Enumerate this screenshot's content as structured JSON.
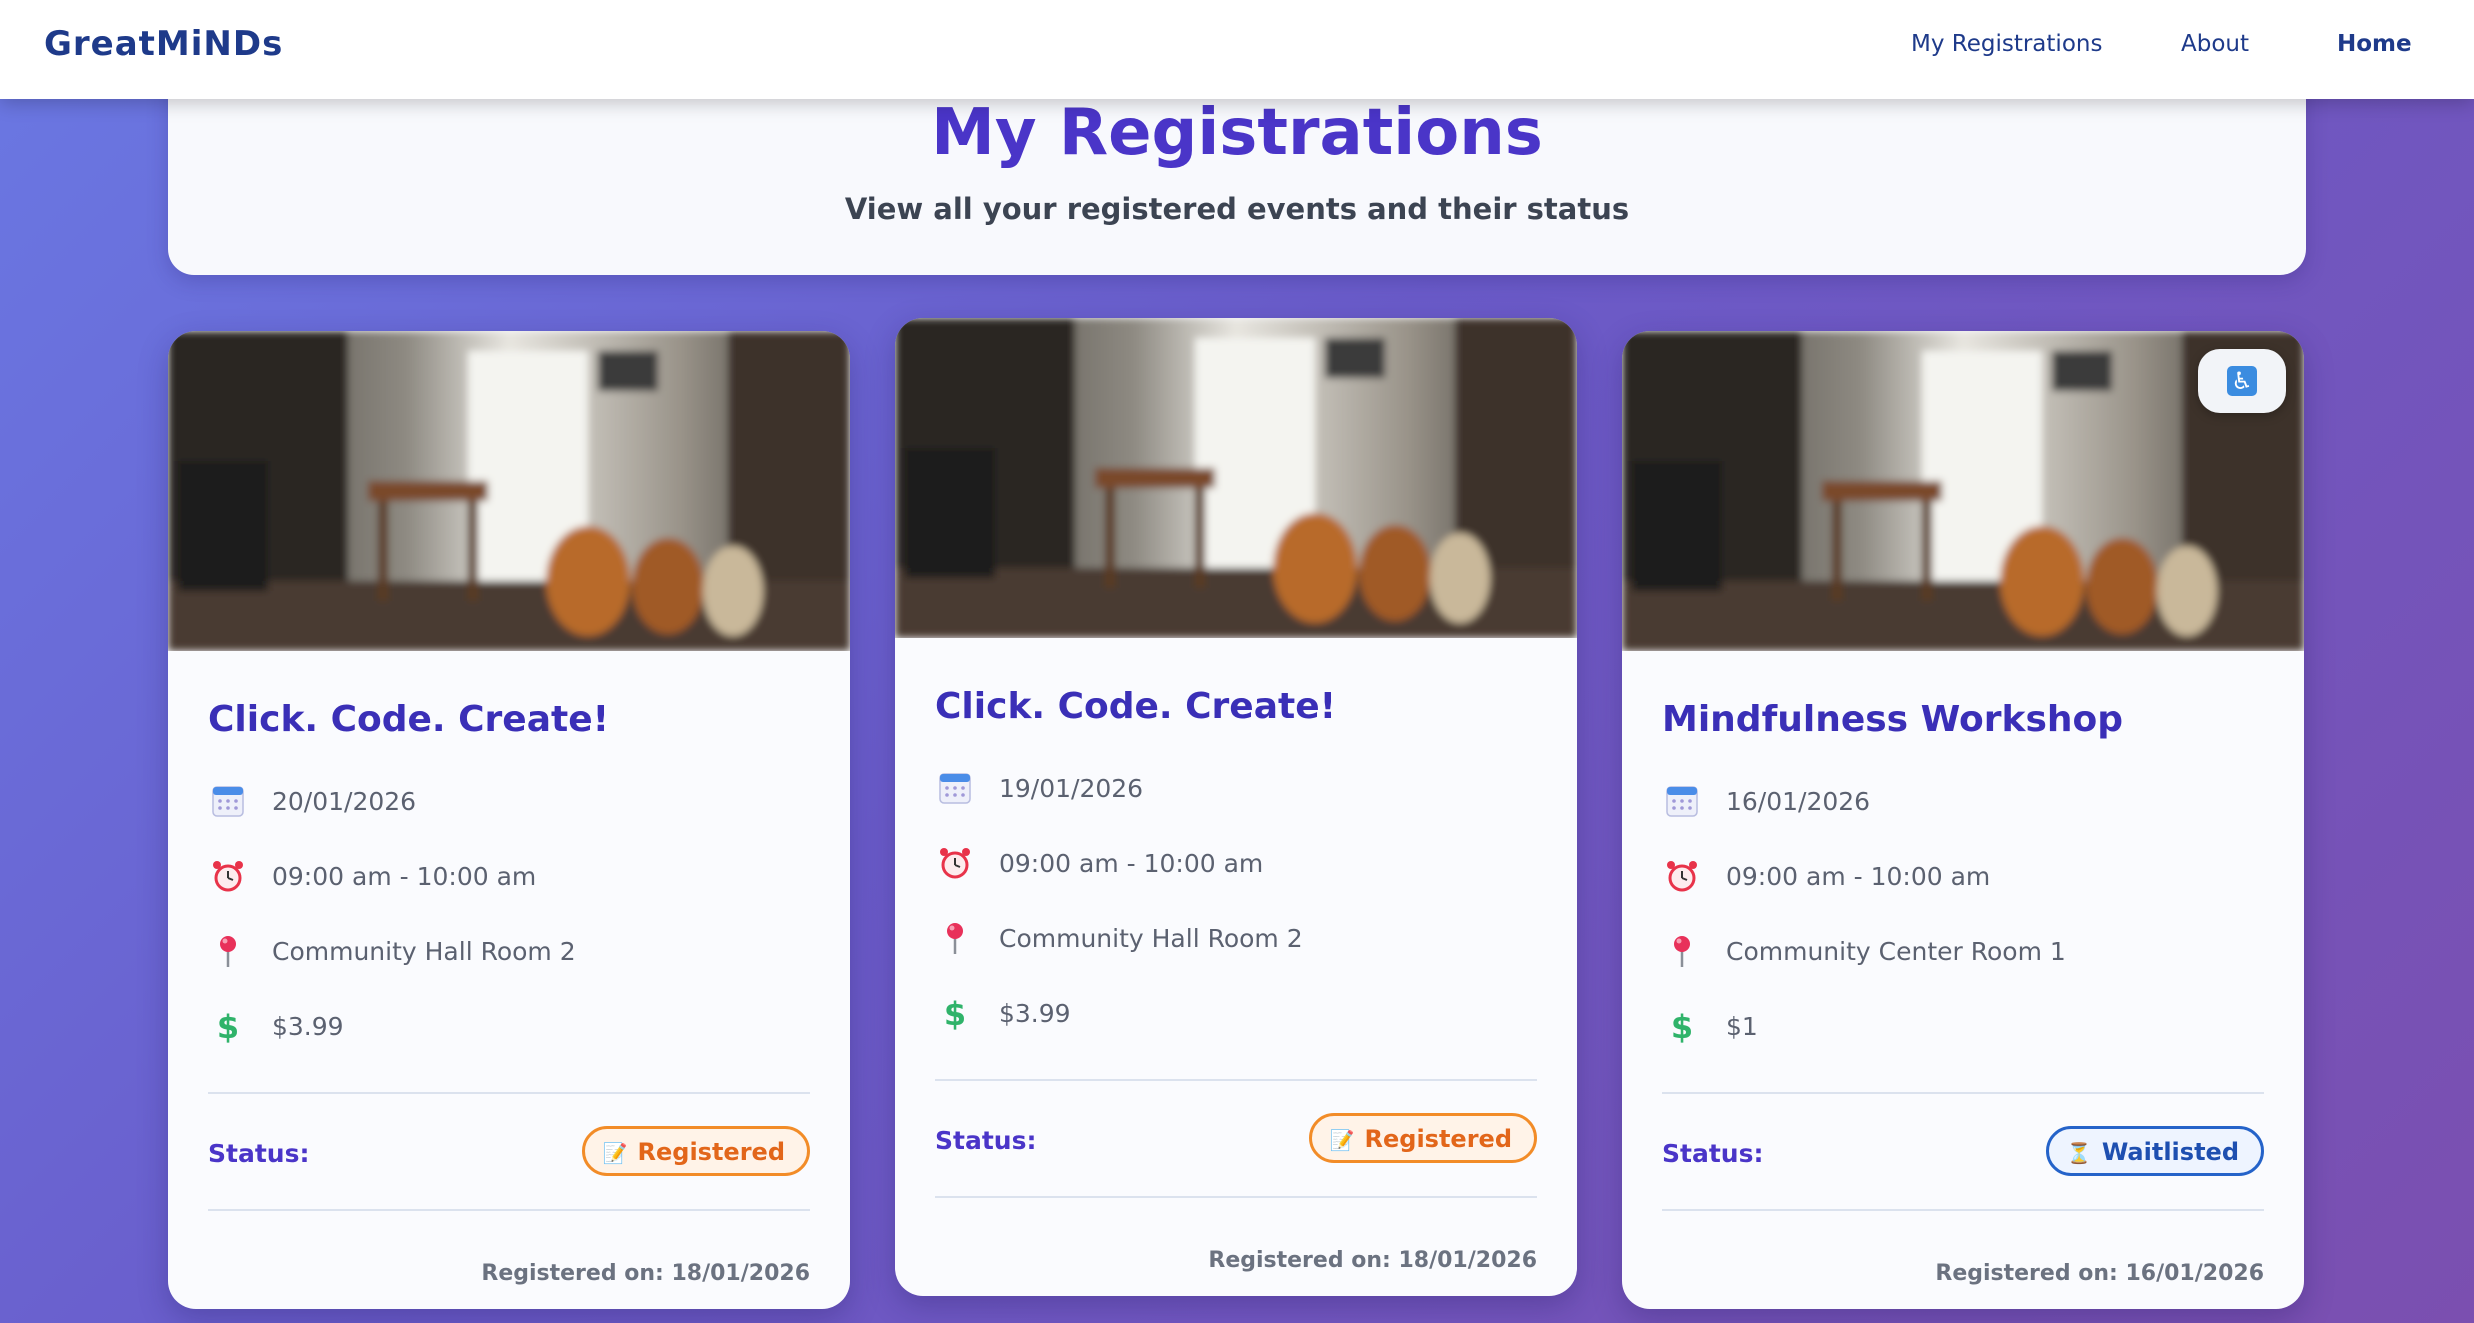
{
  "nav": {
    "brand": "GreatMiNDs",
    "links": [
      {
        "label": "My Registrations",
        "active": false
      },
      {
        "label": "About",
        "active": false
      },
      {
        "label": "Home",
        "active": true
      }
    ]
  },
  "header": {
    "title": "My Registrations",
    "subtitle": "View all your registered events and their status"
  },
  "cards": [
    {
      "title": "Click. Code. Create!",
      "date": "20/01/2026",
      "time": "09:00 am - 10:00 am",
      "location": "Community Hall Room 2",
      "price": "$3.99",
      "status_label": "Status:",
      "status": "Registered",
      "status_icon": "memo-icon",
      "registered_on": "Registered on: 18/01/2026",
      "accessible": false
    },
    {
      "title": "Click. Code. Create!",
      "date": "19/01/2026",
      "time": "09:00 am - 10:00 am",
      "location": "Community Hall Room 2",
      "price": "$3.99",
      "status_label": "Status:",
      "status": "Registered",
      "status_icon": "memo-icon",
      "registered_on": "Registered on: 18/01/2026",
      "accessible": false
    },
    {
      "title": "Mindfulness Workshop",
      "date": "16/01/2026",
      "time": "09:00 am - 10:00 am",
      "location": "Community Center Room 1",
      "price": "$1",
      "status_label": "Status:",
      "status": "Waitlisted",
      "status_icon": "hourglass-icon",
      "registered_on": "Registered on: 16/01/2026",
      "accessible": true,
      "accessible_icon": "wheelchair-icon"
    }
  ],
  "colors": {
    "brand": "#1e3a8a",
    "title": "#4a35c8",
    "registered": "#f28c28",
    "waitlisted": "#2563c9"
  }
}
